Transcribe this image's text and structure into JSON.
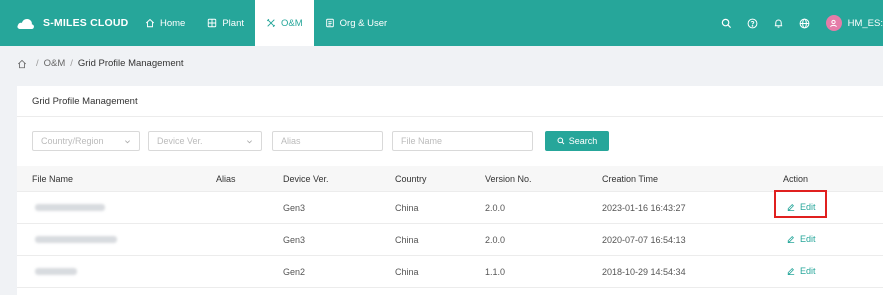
{
  "brand": {
    "name": "S-MILES CLOUD"
  },
  "nav": {
    "items": [
      {
        "label": "Home",
        "icon": "home-icon",
        "active": false
      },
      {
        "label": "Plant",
        "icon": "grid-icon",
        "active": false
      },
      {
        "label": "O&M",
        "icon": "tools-icon",
        "active": true
      },
      {
        "label": "Org & User",
        "icon": "document-icon",
        "active": false
      }
    ]
  },
  "header_right": {
    "icons": [
      "search-icon",
      "help-icon",
      "bell-icon",
      "globe-icon"
    ],
    "user_name": "HM_ES:",
    "avatar_color": "#e57ca8"
  },
  "breadcrumb": {
    "sections": [
      "O&M"
    ],
    "current": "Grid Profile Management"
  },
  "page": {
    "title": "Grid Profile Management"
  },
  "filters": {
    "country_placeholder": "Country/Region",
    "device_ver_placeholder": "Device Ver.",
    "alias_placeholder": "Alias",
    "file_name_placeholder": "File Name",
    "search_label": "Search"
  },
  "table": {
    "columns": [
      "File Name",
      "Alias",
      "Device Ver.",
      "Country",
      "Version No.",
      "Creation Time",
      "Action"
    ],
    "rows": [
      {
        "file_name": "",
        "alias": "",
        "device_ver": "Gen3",
        "country": "China",
        "version_no": "2.0.0",
        "creation_time": "2023-01-16 16:43:27",
        "action": "Edit"
      },
      {
        "file_name": "",
        "alias": "",
        "device_ver": "Gen3",
        "country": "China",
        "version_no": "2.0.0",
        "creation_time": "2020-07-07 16:54:13",
        "action": "Edit"
      },
      {
        "file_name": "",
        "alias": "",
        "device_ver": "Gen2",
        "country": "China",
        "version_no": "1.1.0",
        "creation_time": "2018-10-29 14:54:34",
        "action": "Edit"
      }
    ]
  },
  "colors": {
    "accent": "#26a69a",
    "highlight": "#e0201f"
  }
}
